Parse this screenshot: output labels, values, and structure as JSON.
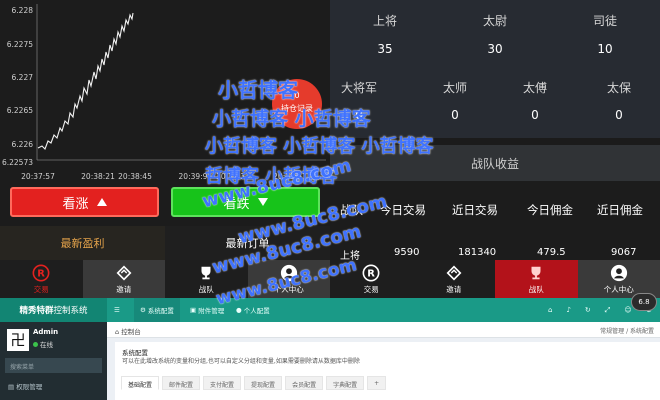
{
  "chart": {
    "y_ticks": [
      "6.228",
      "6.2275",
      "6.227",
      "6.2265",
      "6.226",
      "6.22573"
    ],
    "x_ticks": [
      "20:37:57",
      "20:38:21",
      "20:38:45",
      "20:39:9",
      "20:39:33",
      "20:39:57"
    ]
  },
  "hold_badge": {
    "count": "0",
    "label": "持仓记录"
  },
  "buttons": {
    "up": "看涨",
    "down": "看跌"
  },
  "tabs": {
    "latest_profit": "最新盈利",
    "latest_orders": "最新订单"
  },
  "ranks": {
    "row1": [
      {
        "title": "上将",
        "value": "35"
      },
      {
        "title": "太尉",
        "value": "30"
      },
      {
        "title": "司徒",
        "value": "10"
      }
    ],
    "row2": [
      {
        "title": "大将军",
        "value": "0"
      },
      {
        "title": "太师",
        "value": "0"
      },
      {
        "title": "太傅",
        "value": "0"
      },
      {
        "title": "太保",
        "value": "0"
      }
    ]
  },
  "income": {
    "title": "战队收益",
    "headers": [
      "战队",
      "今日交易",
      "近日交易",
      "今日佣金",
      "近日佣金"
    ],
    "row": [
      "上将",
      "9590",
      "181340",
      "479.5",
      "9067"
    ]
  },
  "nav": {
    "items": [
      {
        "label": "交易",
        "icon": "trade-r-icon"
      },
      {
        "label": "邀请",
        "icon": "invite-icon"
      },
      {
        "label": "战队",
        "icon": "trophy-icon"
      },
      {
        "label": "个人中心",
        "icon": "user-icon"
      },
      {
        "label": "交易",
        "icon": "trade-r-icon"
      },
      {
        "label": "邀请",
        "icon": "invite-icon"
      },
      {
        "label": "战队",
        "icon": "trophy-icon"
      },
      {
        "label": "个人中心",
        "icon": "user-icon"
      }
    ],
    "badge": "6.8"
  },
  "admin": {
    "brand_bold": "精秀特群",
    "brand_thin": "控制系统",
    "menu": [
      "系统配置",
      "附件管理",
      "个人配置"
    ],
    "user": "Admin",
    "status": "在线",
    "search_placeholder": "搜索菜单",
    "side_item": "权限管理",
    "crumb_home": "控制台",
    "crumb_right": "常规管理 / 系统配置",
    "box_title": "系统配置",
    "box_desc": "可以在此增改系统的变量和分组,也可以自定义分组和变量,如果需要删除请从数据库中删除",
    "tabs": [
      "基础配置",
      "邮件配置",
      "支付配置",
      "提现配置",
      "会员配置",
      "字典配置",
      "+"
    ]
  },
  "watermark": {
    "line1": "小哲博客",
    "line2": "小哲博客 小哲博客",
    "line3": "小哲博客 小哲博客 小哲博客",
    "line4": "哲博客 小哲博客",
    "url1": "www.8uc8.com",
    "url2": "www.8uc8.com",
    "url3": "www.8uc8.com",
    "url4": "www.8uc8.com"
  },
  "colors": {
    "up": "#e3211f",
    "down": "#17c31a",
    "accent_gold": "#e3a24a",
    "admin_teal": "#1a9a87"
  }
}
